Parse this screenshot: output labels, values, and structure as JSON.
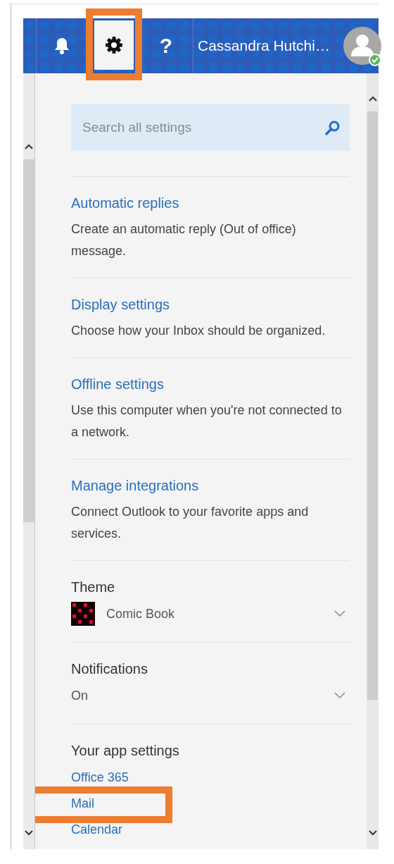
{
  "header": {
    "buttons": [
      {
        "kind": "bell",
        "selected": false,
        "annotated": false
      },
      {
        "kind": "gear",
        "selected": true,
        "annotated": true
      },
      {
        "kind": "help",
        "text": "?",
        "selected": false,
        "annotated": false
      }
    ],
    "user_name": "Cassandra Hutchi…",
    "online": true
  },
  "search": {
    "placeholder": "Search all settings"
  },
  "sections": [
    {
      "kind": "link",
      "title": "Automatic replies",
      "description": "Create an automatic reply (Out of office) message."
    },
    {
      "kind": "link",
      "title": "Display settings",
      "description": "Choose how your Inbox should be organized."
    },
    {
      "kind": "link",
      "title": "Offline settings",
      "description": "Use this computer when you're not connected to a network."
    },
    {
      "kind": "link",
      "title": "Manage integrations",
      "description": "Connect Outlook to your favorite apps and services."
    },
    {
      "kind": "dropdown",
      "label": "Theme",
      "value": "Comic Book",
      "swatch": true
    },
    {
      "kind": "dropdown",
      "label": "Notifications",
      "value": "On",
      "swatch": false
    }
  ],
  "app_settings": {
    "heading": "Your app settings",
    "links": [
      {
        "label": "Office 365",
        "annotated": false
      },
      {
        "label": "Mail",
        "annotated": true
      },
      {
        "label": "Calendar",
        "annotated": false
      }
    ]
  }
}
